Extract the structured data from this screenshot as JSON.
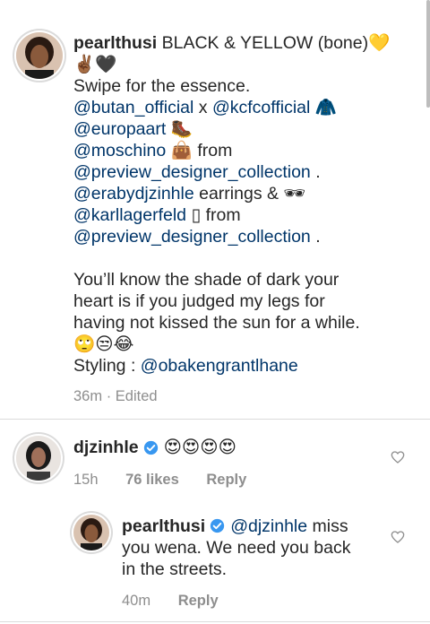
{
  "caption": {
    "username": "pearlthusi",
    "title": "BLACK & YELLOW (bone)💛",
    "line2": "✌🏾🖤",
    "swipe": "Swipe for the essence.",
    "credit1_a": "@butan_official",
    "credit1_b": " x ",
    "credit1_c": "@kcfcofficial",
    "credit1_emoji": "🧥",
    "credit2": "@europaart",
    "credit2_emoji": "🥾",
    "credit3": "@moschino",
    "credit3_emoji": "👜",
    "credit3_from": " from",
    "credit4": "@preview_designer_collection",
    "credit4_end": " .",
    "credit5": "@erabydjzinhle",
    "credit5_text": " earrings & ",
    "credit5_emoji": "🕶",
    "credit6": "@karllagerfeld",
    "credit6_text": " ▯ from",
    "credit7": "@preview_designer_collection",
    "credit7_end": " .",
    "para_line1": "You’ll know the shade of dark your",
    "para_line2": "heart is if you judged my legs for",
    "para_line3": "having not kissed the sun for a while.",
    "para_emojis": "🙄😒😂",
    "styling_label": "Styling : ",
    "styling_handle": "@obakengrantlhane",
    "time": "36m",
    "edited": " · Edited"
  },
  "comments": [
    {
      "username": "djzinhle",
      "text": "😍😍😍😍",
      "time": "15h",
      "likes": "76 likes",
      "reply": "Reply"
    },
    {
      "username": "pearlthusi",
      "mention": "@djzinhle",
      "text_line1": " miss",
      "text_line2": "you wena. We need you back",
      "text_line3": "in the streets.",
      "time": "40m",
      "reply": "Reply"
    }
  ],
  "colors": {
    "text": "#262626",
    "mention": "#003569",
    "meta": "#8e8e8e",
    "verified": "#3897f0",
    "divider": "#dbdbdb"
  },
  "icons": {
    "verified": "verified-badge-icon",
    "like": "heart-outline-icon"
  }
}
